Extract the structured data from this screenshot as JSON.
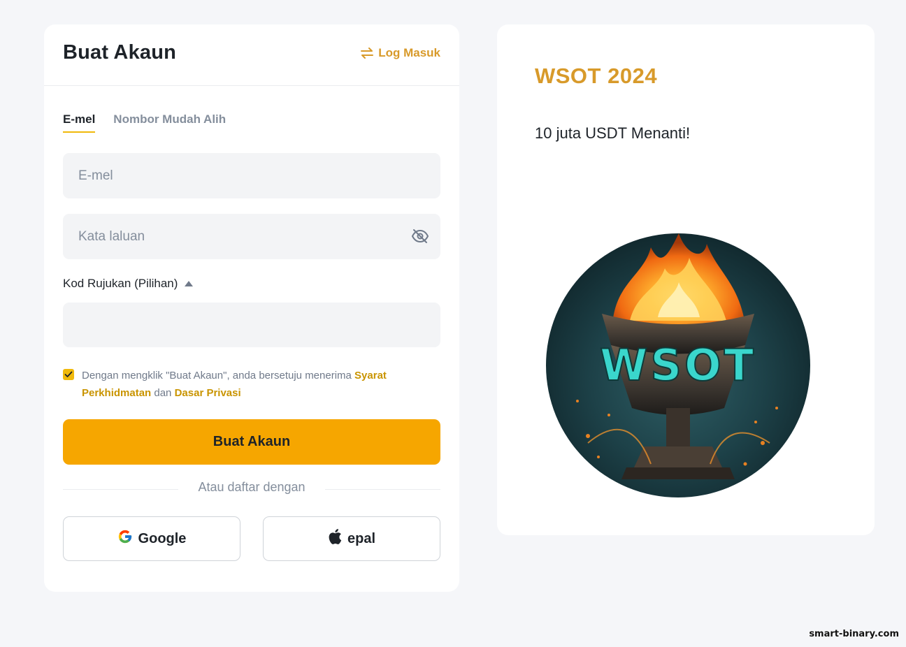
{
  "header": {
    "title": "Buat Akaun",
    "login_label": "Log Masuk"
  },
  "tabs": [
    {
      "label": "E-mel",
      "active": true
    },
    {
      "label": "Nombor Mudah Alih",
      "active": false
    }
  ],
  "form": {
    "email_placeholder": "E-mel",
    "email_value": "",
    "password_placeholder": "Kata laluan",
    "password_value": "",
    "referral_label": "Kod Rujukan (Pilihan)",
    "referral_value": "",
    "terms_checked": true,
    "terms_prefix": "Dengan mengklik \"Buat Akaun\", anda bersetuju menerima ",
    "terms_link": "Syarat Perkhidmatan",
    "terms_middle": " dan ",
    "privacy_link": "Dasar Privasi",
    "submit_label": "Buat Akaun",
    "divider_text": "Atau daftar dengan",
    "google_label": "Google",
    "apple_label": "epal"
  },
  "promo": {
    "title": "WSOT 2024",
    "subtitle": "10 juta USDT Menanti!",
    "image_text": "WSOT"
  },
  "watermark": "smart-binary.com",
  "colors": {
    "accent": "#d89a2a",
    "primary_button": "#f6a600",
    "page_bg": "#f5f6f9",
    "input_bg": "#f3f4f6"
  }
}
